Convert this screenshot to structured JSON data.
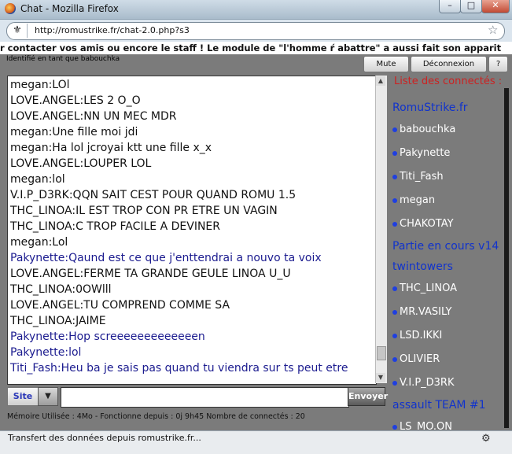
{
  "window": {
    "title": "Chat - Mozilla Firefox",
    "minimize": "–",
    "maximize": "□",
    "close": "✕"
  },
  "browser": {
    "url": "http://romustrike.fr/chat-2.0.php?s3",
    "bookmark_star": "☆",
    "status": "Transfert des données depuis romustrike.fr..."
  },
  "chat": {
    "marquee": "r contacter vos amis ou encore le staff ! Le module de \"l'homme ŕ abattre\" a aussi fait son apparit",
    "identity": "Identifié en tant que babouchka",
    "buttons": {
      "mute": "Mute",
      "disconnect": "Déconnexion",
      "help": "?"
    },
    "messages": [
      {
        "text": "megan:LOl",
        "style": "normal"
      },
      {
        "text": "LOVE.ANGEL:LES 2 O_O",
        "style": "normal"
      },
      {
        "text": "LOVE.ANGEL:NN UN MEC MDR",
        "style": "normal"
      },
      {
        "text": "megan:Une fille moi jdi",
        "style": "normal"
      },
      {
        "text": "megan:Ha lol jcroyai ktt une fille x_x",
        "style": "normal"
      },
      {
        "text": "LOVE.ANGEL:LOUPER LOL",
        "style": "normal"
      },
      {
        "text": "megan:lol",
        "style": "normal"
      },
      {
        "text": "V.I.P_D3RK:QQN SAIT CEST POUR QUAND ROMU 1.5",
        "style": "normal"
      },
      {
        "text": "THC_LINOA:IL EST TROP CON PR ETRE UN VAGIN",
        "style": "normal"
      },
      {
        "text": "THC_LINOA:C TROP FACILE A DEVINER",
        "style": "normal"
      },
      {
        "text": "megan:Lol",
        "style": "normal"
      },
      {
        "text": "Pakynette:Qaund est ce que j'enttendrai a nouvo ta voix",
        "style": "pink"
      },
      {
        "text": "LOVE.ANGEL:FERME TA GRANDE GEULE LINOA U_U",
        "style": "normal"
      },
      {
        "text": "THC_LINOA:0OWlll",
        "style": "normal"
      },
      {
        "text": "LOVE.ANGEL:TU COMPREND COMME SA",
        "style": "normal"
      },
      {
        "text": "THC_LINOA:JAIME",
        "style": "normal"
      },
      {
        "text": "Pakynette:Hop screeeeeeeeeeeeen",
        "style": "pink"
      },
      {
        "text": "Pakynette:lol",
        "style": "pink"
      },
      {
        "text": "Titi_Fash:Heu ba je sais pas quand tu viendra sur ts peut etre",
        "style": "pink"
      }
    ],
    "input": {
      "site_label": "Site",
      "value": "",
      "send_label": "Envoyer"
    },
    "footer": "Mémoire Utilisée : 4Mo - Fonctionne depuis : 0j 9h45 Nombre de connectés : 20"
  },
  "sidebar": {
    "title": "Liste des connectés :",
    "entries": [
      {
        "type": "group",
        "label": "RomuStrike.fr"
      },
      {
        "type": "user",
        "label": "babouchka"
      },
      {
        "type": "user",
        "label": "Pakynette"
      },
      {
        "type": "user",
        "label": "Titi_Fash"
      },
      {
        "type": "user",
        "label": "megan"
      },
      {
        "type": "user",
        "label": "CHAKOTAY"
      },
      {
        "type": "group",
        "label": "Partie en cours v14"
      },
      {
        "type": "group",
        "label": "  twintowers"
      },
      {
        "type": "user",
        "label": "THC_LINOA"
      },
      {
        "type": "user",
        "label": "MR.VASILY"
      },
      {
        "type": "user",
        "label": "LSD.IKKI"
      },
      {
        "type": "user",
        "label": "OLIVIER"
      },
      {
        "type": "user",
        "label": "V.I.P_D3RK"
      },
      {
        "type": "group",
        "label": "  assault TEAM #1"
      },
      {
        "type": "user",
        "label": "LS_MO.ON"
      }
    ]
  }
}
